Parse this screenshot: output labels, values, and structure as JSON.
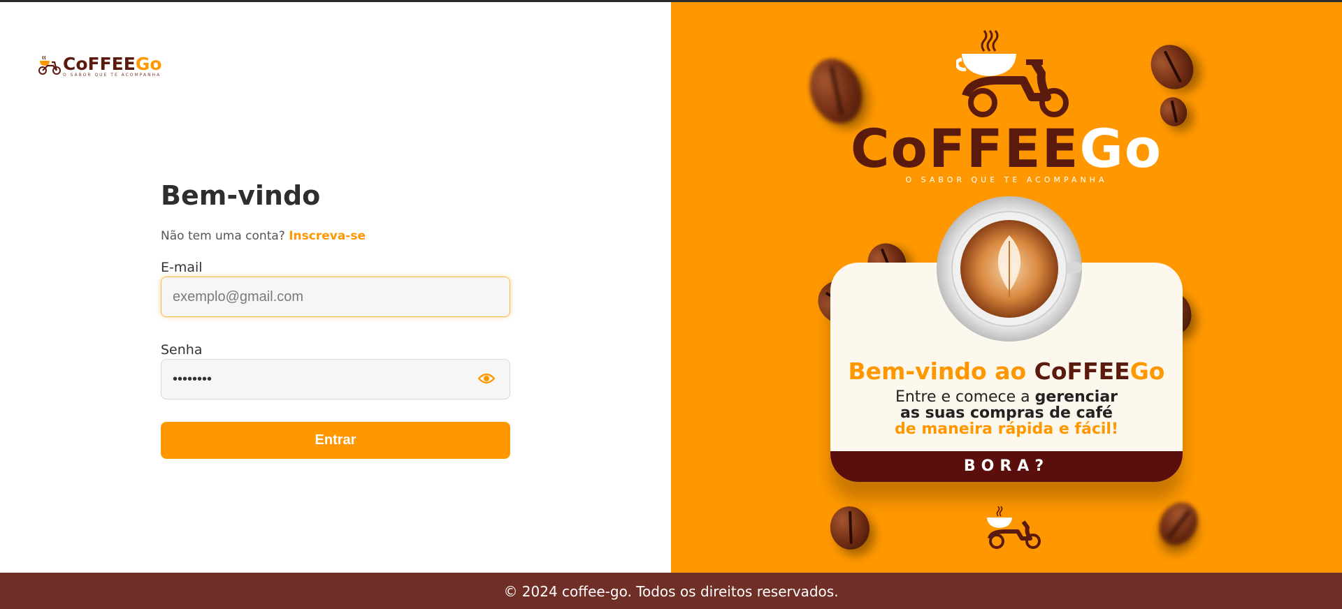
{
  "brand": {
    "name_part1": "CoFFEE",
    "name_part2": "Go",
    "tagline": "O SABOR QUE TE ACOMPANHA"
  },
  "login": {
    "title": "Bem-vindo",
    "no_account_text": "Não tem uma conta?",
    "signup_link": "Inscreva-se",
    "email_label": "E-mail",
    "email_placeholder": "exemplo@gmail.com",
    "email_value": "",
    "password_label": "Senha",
    "password_value": "••••••••",
    "submit_label": "Entrar"
  },
  "promo": {
    "title_prefix": "Bem-vindo ao",
    "title_brand1": "CoFFEE",
    "title_brand2": "Go",
    "line1_prefix": "Entre e comece a",
    "line1_bold": "gerenciar",
    "line2": "as suas compras de café",
    "line3": "de maneira rápida e fácil!",
    "cta": "BORA?"
  },
  "footer": {
    "text": "© 2024 coffee-go. Todos os direitos reservados."
  },
  "colors": {
    "accent": "#ff9800",
    "brown": "#5b1a0e",
    "footer": "#6f2f27"
  },
  "icons": {
    "password_toggle": "eye-icon",
    "logo": "coffee-cup-motorcycle-icon"
  }
}
